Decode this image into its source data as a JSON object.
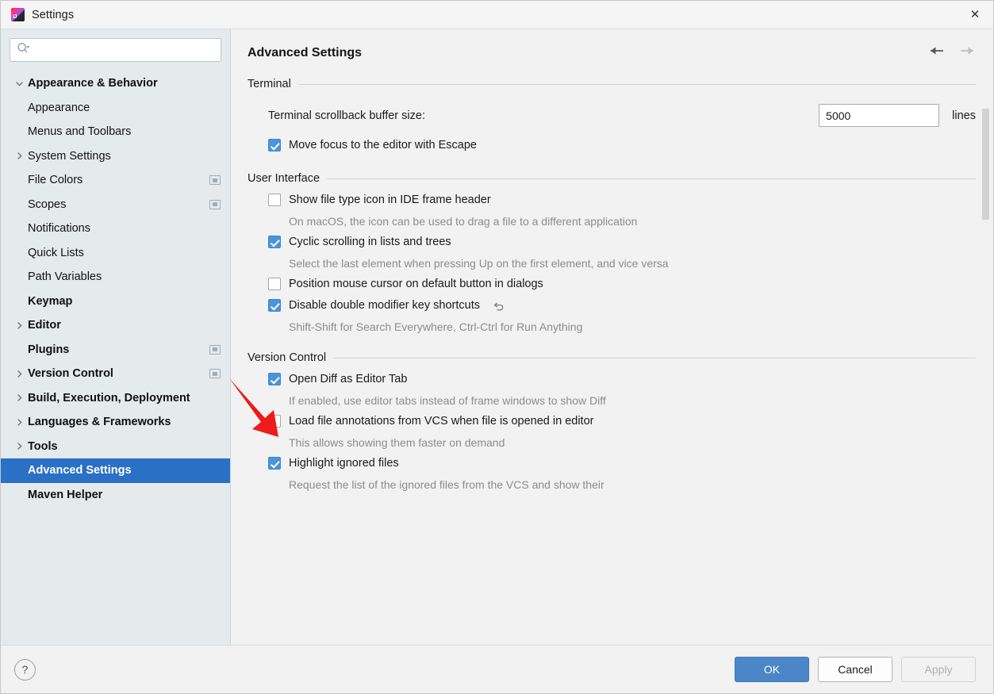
{
  "window": {
    "title": "Settings",
    "app_icon": "intellij-idea-icon",
    "close_label": "✕"
  },
  "sidebar": {
    "search": {
      "placeholder": "",
      "value": "",
      "icon": "search-icon"
    },
    "tree": [
      {
        "label": "Appearance & Behavior",
        "level": 0,
        "twisty": "expanded",
        "selected": false,
        "badge": false
      },
      {
        "label": "Appearance",
        "level": 1,
        "twisty": "none",
        "selected": false,
        "badge": false
      },
      {
        "label": "Menus and Toolbars",
        "level": 1,
        "twisty": "none",
        "selected": false,
        "badge": false
      },
      {
        "label": "System Settings",
        "level": 1,
        "twisty": "collapsed",
        "selected": false,
        "badge": false
      },
      {
        "label": "File Colors",
        "level": 1,
        "twisty": "none",
        "selected": false,
        "badge": true
      },
      {
        "label": "Scopes",
        "level": 1,
        "twisty": "none",
        "selected": false,
        "badge": true
      },
      {
        "label": "Notifications",
        "level": 1,
        "twisty": "none",
        "selected": false,
        "badge": false
      },
      {
        "label": "Quick Lists",
        "level": 1,
        "twisty": "none",
        "selected": false,
        "badge": false
      },
      {
        "label": "Path Variables",
        "level": 1,
        "twisty": "none",
        "selected": false,
        "badge": false
      },
      {
        "label": "Keymap",
        "level": 0,
        "twisty": "none",
        "selected": false,
        "badge": false
      },
      {
        "label": "Editor",
        "level": 0,
        "twisty": "collapsed",
        "selected": false,
        "badge": false
      },
      {
        "label": "Plugins",
        "level": 0,
        "twisty": "none",
        "selected": false,
        "badge": true
      },
      {
        "label": "Version Control",
        "level": 0,
        "twisty": "collapsed",
        "selected": false,
        "badge": true
      },
      {
        "label": "Build, Execution, Deployment",
        "level": 0,
        "twisty": "collapsed",
        "selected": false,
        "badge": false
      },
      {
        "label": "Languages & Frameworks",
        "level": 0,
        "twisty": "collapsed",
        "selected": false,
        "badge": false
      },
      {
        "label": "Tools",
        "level": 0,
        "twisty": "collapsed",
        "selected": false,
        "badge": false
      },
      {
        "label": "Advanced Settings",
        "level": 0,
        "twisty": "none",
        "selected": true,
        "badge": false
      },
      {
        "label": "Maven Helper",
        "level": 0,
        "twisty": "none",
        "selected": false,
        "badge": false
      }
    ]
  },
  "content": {
    "title": "Advanced Settings",
    "nav": {
      "back": "back-arrow-icon",
      "forward": "forward-arrow-icon",
      "back_enabled": true,
      "forward_enabled": false
    },
    "sections": [
      {
        "name": "Terminal",
        "field": {
          "label": "Terminal scrollback buffer size:",
          "value": "5000",
          "unit": "lines"
        },
        "options": [
          {
            "label": "Move focus to the editor with Escape",
            "checked": true,
            "desc": "",
            "revert": false
          }
        ]
      },
      {
        "name": "User Interface",
        "options": [
          {
            "label": "Show file type icon in IDE frame header",
            "checked": false,
            "desc": "On macOS, the icon can be used to drag a file to a different application",
            "revert": false
          },
          {
            "label": "Cyclic scrolling in lists and trees",
            "checked": true,
            "desc": "Select the last element when pressing Up on the first element, and vice versa",
            "revert": false
          },
          {
            "label": "Position mouse cursor on default button in dialogs",
            "checked": false,
            "desc": "",
            "revert": false
          },
          {
            "label": "Disable double modifier key shortcuts",
            "checked": true,
            "desc": "Shift-Shift for Search Everywhere, Ctrl-Ctrl for Run Anything",
            "revert": true
          }
        ]
      },
      {
        "name": "Version Control",
        "options": [
          {
            "label": "Open Diff as Editor Tab",
            "checked": true,
            "desc": "If enabled, use editor tabs instead of frame windows to show Diff",
            "revert": false
          },
          {
            "label": "Load file annotations from VCS when file is opened in editor",
            "checked": false,
            "desc": "This allows showing them faster on demand",
            "revert": false
          },
          {
            "label": "Highlight ignored files",
            "checked": true,
            "desc": "Request the list of the ignored files from the VCS and show their",
            "revert": false
          }
        ]
      }
    ]
  },
  "footer": {
    "help": "?",
    "ok": "OK",
    "cancel": "Cancel",
    "apply": "Apply"
  },
  "annotation": {
    "type": "red-arrow",
    "color": "#ee1b1b",
    "points_at": "Disable double modifier key shortcuts"
  },
  "colors": {
    "accent": "#2a70c4",
    "checkbox_on": "#4a94db",
    "sidebar_bg": "#e5eaed",
    "content_bg": "#f2f2f2",
    "annotation_red": "#ee1b1b"
  }
}
